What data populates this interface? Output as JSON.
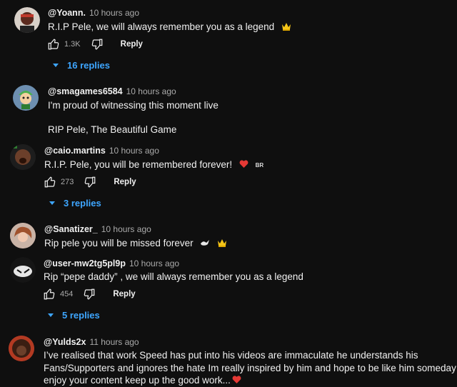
{
  "comments": [
    {
      "author": "@Yoann.",
      "time": "10 hours ago",
      "lines": [
        "R.I.P Pele, we will always remember you as a legend"
      ],
      "likes": "1.3K",
      "reply_label": "Reply",
      "replies": "16 replies",
      "emoji": [
        "crown-icon"
      ]
    },
    {
      "author": "@smagames6584",
      "time": "10 hours ago",
      "lines": [
        "I'm proud of witnessing this moment live",
        "RIP Pele, The Beautiful Game"
      ]
    },
    {
      "author": "@caio.martins",
      "time": "10 hours ago",
      "lines": [
        "R.I.P. Pele, you will be remembered forever!"
      ],
      "likes": "273",
      "reply_label": "Reply",
      "replies": "3 replies",
      "tag": "BR",
      "emoji": [
        "heart-icon",
        "flag-icon"
      ]
    },
    {
      "author": "@Sanatizer_",
      "time": "10 hours ago",
      "lines": [
        "Rip pele you will be missed forever"
      ],
      "emoji": [
        "dove-icon",
        "crown-icon"
      ]
    },
    {
      "author": "@user-mw2tg5pl9p",
      "time": "10 hours ago",
      "lines": [
        "Rip “pepe daddy” , we will always remember you as a legend"
      ],
      "likes": "454",
      "reply_label": "Reply",
      "replies": "5 replies"
    },
    {
      "author": "@Yulds2x",
      "time": "11 hours ago",
      "lines": [
        "I’ve realised that work Speed has put into his videos are immaculate he understands his",
        "Fans/Supporters and ignores the hate Im really inspired by him and hope to be like him someday I",
        "enjoy your content keep up the good work..."
      ],
      "emoji": [
        "heart-icon"
      ]
    }
  ],
  "colors": {
    "background": "#0f0f0f",
    "link": "#3ea6ff",
    "heart": "#e53935",
    "crown": "#f5c518"
  }
}
